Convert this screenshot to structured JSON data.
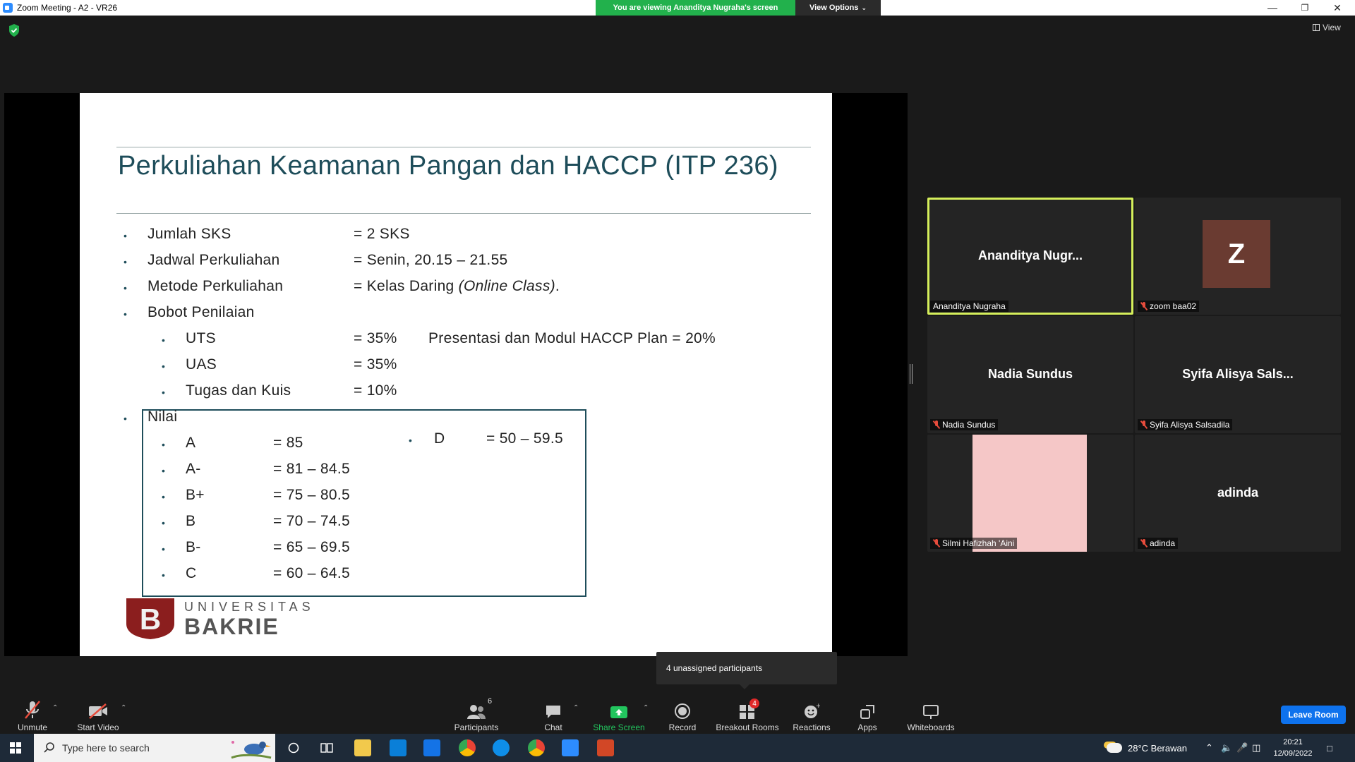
{
  "window": {
    "title": "Zoom Meeting - A2 - VR26",
    "viewing_banner": "You are viewing Ananditya Nugraha's screen",
    "view_options": "View Options",
    "view_button": "View"
  },
  "slide": {
    "title": "Perkuliahan Keamanan Pangan dan HACCP (ITP 236)",
    "items": [
      {
        "label": "Jumlah SKS",
        "value": "= 2 SKS"
      },
      {
        "label": "Jadwal Perkuliahan",
        "value": "= Senin, 20.15 – 21.55"
      },
      {
        "label": "Metode Perkuliahan",
        "value_prefix": "= Kelas Daring ",
        "value_italic": "(Online Class)",
        "value_suffix": "."
      },
      {
        "label": "Bobot Penilaian"
      }
    ],
    "bobot": [
      {
        "label": "UTS",
        "value": "= 35%"
      },
      {
        "label": "UAS",
        "value": "= 35%"
      },
      {
        "label": "Tugas dan Kuis",
        "value": "= 10%"
      }
    ],
    "presentasi": "Presentasi dan Modul HACCP Plan = 20%",
    "nilai_label": "Nilai",
    "grades": [
      {
        "grade": "A",
        "range": "= 85"
      },
      {
        "grade": "A-",
        "range": "= 81 – 84.5"
      },
      {
        "grade": "B+",
        "range": "= 75 – 80.5"
      },
      {
        "grade": "B",
        "range": "= 70 – 74.5"
      },
      {
        "grade": "B-",
        "range": "= 65 – 69.5"
      },
      {
        "grade": "C",
        "range": "= 60 – 64.5"
      }
    ],
    "grade_d": {
      "grade": "D",
      "range": "= 50 – 59.5"
    },
    "logo_line1": "UNIVERSITAS",
    "logo_line2": "BAKRIE",
    "logo_letter": "B"
  },
  "participants": [
    {
      "display": "Ananditya  Nugr...",
      "label": "Ananditya Nugraha",
      "muted": false,
      "active": true
    },
    {
      "display": "Z",
      "label": "zoom baa02",
      "muted": true
    },
    {
      "display": "Nadia  Sundus",
      "label": "Nadia Sundus",
      "muted": true
    },
    {
      "display": "Syifa  Alisya  Sals...",
      "label": "Syifa Alisya Salsadila",
      "muted": true
    },
    {
      "display": "",
      "label": "Silmi Hafizhah 'Aini",
      "muted": true
    },
    {
      "display": "adinda",
      "label": "adinda",
      "muted": true
    }
  ],
  "tooltip": "4 unassigned participants",
  "toolbar": {
    "unmute": "Unmute",
    "start_video": "Start Video",
    "participants": "Participants",
    "participants_count": "6",
    "chat": "Chat",
    "share_screen": "Share Screen",
    "record": "Record",
    "breakout_rooms": "Breakout Rooms",
    "breakout_count": "4",
    "reactions": "Reactions",
    "apps": "Apps",
    "whiteboards": "Whiteboards",
    "leave": "Leave Room"
  },
  "taskbar": {
    "search_placeholder": "Type here to search",
    "weather": "28°C  Berawan",
    "time": "20:21",
    "date": "12/09/2022"
  },
  "colors": {
    "accent_green": "#22b14c",
    "zoom_blue": "#0e72ed",
    "active_speaker": "#d5ef5b",
    "slide_title": "#1e4d5a"
  }
}
